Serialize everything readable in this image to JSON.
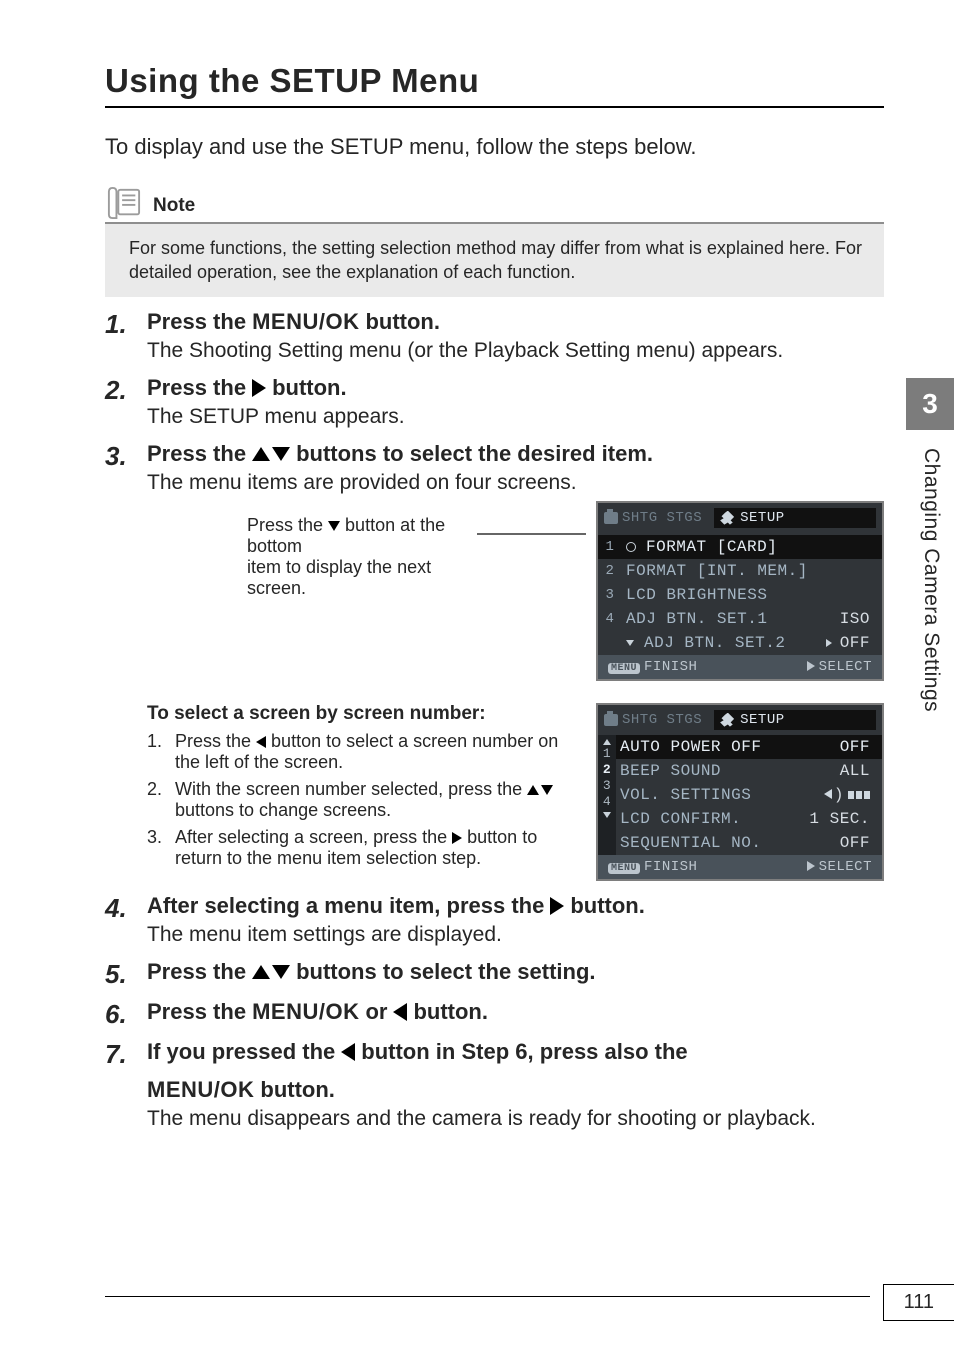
{
  "title": "Using the SETUP Menu",
  "intro": "To display and use the SETUP menu, follow the steps below.",
  "note": {
    "label": "Note",
    "body": "For some functions, the setting selection method may differ from what is explained here. For detailed operation, see the explanation of each function."
  },
  "steps": {
    "1": {
      "num": "1.",
      "title_a": "Press the",
      "menuok": "MENU/OK",
      "title_b": "button.",
      "desc": "The Shooting Setting menu (or the Playback Setting menu) appears."
    },
    "2": {
      "num": "2.",
      "title_a": "Press the",
      "title_b": "button.",
      "desc": "The SETUP menu appears."
    },
    "3": {
      "num": "3.",
      "title_a": "Press the",
      "title_b": "buttons to select the desired item.",
      "desc": "The menu items are provided on four screens."
    },
    "4": {
      "num": "4.",
      "title_a": "After selecting a menu item, press the",
      "title_b": "button.",
      "desc": "The menu item settings are displayed."
    },
    "5": {
      "num": "5.",
      "title_a": "Press the",
      "title_b": "buttons to select the setting."
    },
    "6": {
      "num": "6.",
      "title_a": "Press the",
      "menuok": "MENU/OK",
      "title_b": "or",
      "title_c": "button."
    },
    "7": {
      "num": "7.",
      "title_a": "If you pressed the",
      "title_b": "button in Step 6, press also the",
      "menuok": "MENU/OK",
      "title_c": "button.",
      "desc": "The menu disappears and the camera is ready for shooting or playback."
    }
  },
  "callout": {
    "line1": "Press the ",
    "line1b": " button at the bottom",
    "line2": "item to display the next screen."
  },
  "sub": {
    "heading": "To select a screen by screen number:",
    "items": {
      "1": {
        "n": "1.",
        "a": "Press the ",
        "b": " button to select a screen number on the left of the screen."
      },
      "2": {
        "n": "2.",
        "a": "With the screen number selected, press the ",
        "b": " buttons to change screens."
      },
      "3": {
        "n": "3.",
        "a": "After selecting a screen, press the ",
        "b": " button to return to the menu item selection step."
      }
    }
  },
  "menu1": {
    "tab_inactive": "SHTG STGS",
    "tab_active": "SETUP",
    "rows": {
      "1": {
        "n": "1",
        "label": "FORMAT  [CARD]",
        "val": ""
      },
      "2": {
        "n": "2",
        "label": "FORMAT  [INT. MEM.]",
        "val": ""
      },
      "3": {
        "n": "3",
        "label": "LCD BRIGHTNESS",
        "val": ""
      },
      "4": {
        "n": "4",
        "label": "ADJ BTN. SET.1",
        "val": "ISO"
      },
      "5": {
        "n": "",
        "label": "ADJ BTN. SET.2",
        "val": "OFF"
      }
    },
    "footer_left": "FINISH",
    "footer_right": "SELECT"
  },
  "menu2": {
    "tab_inactive": "SHTG STGS",
    "tab_active": "SETUP",
    "col": [
      "1",
      "2",
      "3",
      "4"
    ],
    "rows": {
      "1": {
        "label": "AUTO POWER OFF",
        "val": "OFF"
      },
      "2": {
        "label": "BEEP SOUND",
        "val": "ALL"
      },
      "3": {
        "label": "VOL. SETTINGS",
        "val": ""
      },
      "4": {
        "label": "LCD CONFIRM.",
        "val": "1 SEC."
      },
      "5": {
        "label": "SEQUENTIAL NO.",
        "val": "OFF"
      }
    },
    "footer_left": "FINISH",
    "footer_right": "SELECT"
  },
  "side": {
    "chapter": "3",
    "label": "Changing Camera Settings"
  },
  "page_number": "111"
}
